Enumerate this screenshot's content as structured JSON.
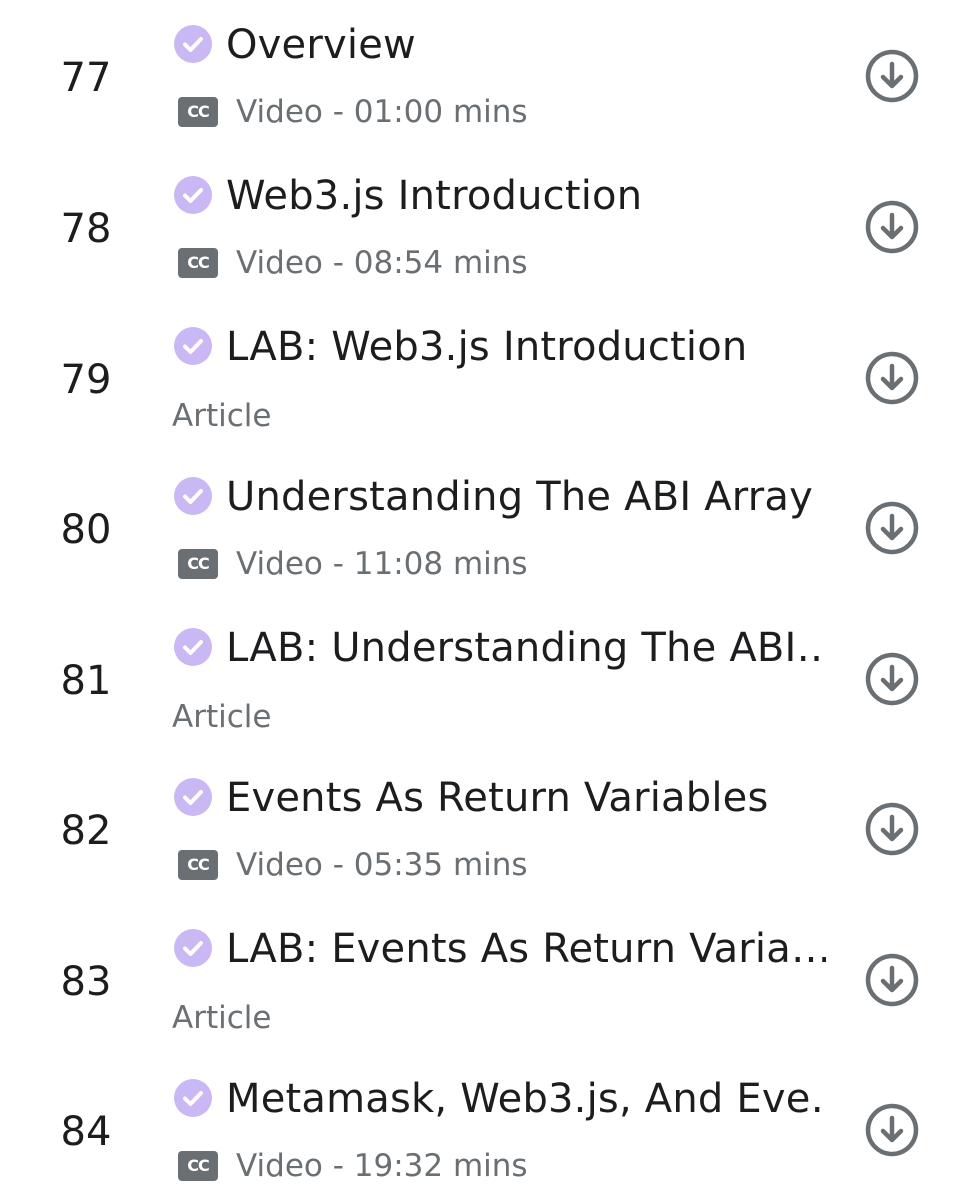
{
  "lectures": [
    {
      "number": "77",
      "title": "Overview",
      "type": "video",
      "meta": "Video - 01:00 mins",
      "completed": true,
      "icons": {
        "status": "check-circle-icon",
        "captions": "cc-icon",
        "action": "download-icon"
      }
    },
    {
      "number": "78",
      "title": "Web3.js Introduction",
      "type": "video",
      "meta": "Video - 08:54 mins",
      "completed": true,
      "icons": {
        "status": "check-circle-icon",
        "captions": "cc-icon",
        "action": "download-icon"
      }
    },
    {
      "number": "79",
      "title": "LAB: Web3.js Introduction",
      "type": "article",
      "meta": "Article",
      "completed": true,
      "icons": {
        "status": "check-circle-icon",
        "action": "download-icon"
      }
    },
    {
      "number": "80",
      "title": "Understanding The ABI Array",
      "type": "video",
      "meta": "Video - 11:08 mins",
      "completed": true,
      "icons": {
        "status": "check-circle-icon",
        "captions": "cc-icon",
        "action": "download-icon"
      }
    },
    {
      "number": "81",
      "title": "LAB: Understanding The ABI…",
      "type": "article",
      "meta": "Article",
      "completed": true,
      "icons": {
        "status": "check-circle-icon",
        "action": "download-icon"
      }
    },
    {
      "number": "82",
      "title": "Events As Return Variables",
      "type": "video",
      "meta": "Video - 05:35 mins",
      "completed": true,
      "icons": {
        "status": "check-circle-icon",
        "captions": "cc-icon",
        "action": "download-icon"
      }
    },
    {
      "number": "83",
      "title": "LAB: Events As Return Varia…",
      "type": "article",
      "meta": "Article",
      "completed": true,
      "icons": {
        "status": "check-circle-icon",
        "action": "download-icon"
      }
    },
    {
      "number": "84",
      "title": "Metamask, Web3.js, And Eve…",
      "type": "video",
      "meta": "Video - 19:32 mins",
      "completed": true,
      "icons": {
        "status": "check-circle-icon",
        "captions": "cc-icon",
        "action": "download-icon"
      }
    }
  ],
  "cc_label": "CC",
  "colors": {
    "check_fill": "#c9b8f3",
    "text_primary": "#1c1d1f",
    "text_secondary": "#6a6f73",
    "icon_gray": "#6a6f73"
  }
}
